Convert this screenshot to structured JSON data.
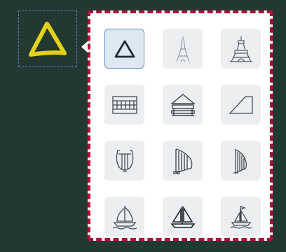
{
  "selected_shape": {
    "icon": "triangle-icon",
    "color": "#e3d21c"
  },
  "palette": {
    "border_color": "#b0103a",
    "items": [
      {
        "icon": "triangle-icon",
        "selected": true
      },
      {
        "icon": "eiffel-tower-icon",
        "selected": false
      },
      {
        "icon": "tokyo-tower-icon",
        "selected": false
      },
      {
        "icon": "dam-gate-icon",
        "selected": false
      },
      {
        "icon": "pavilion-icon",
        "selected": false
      },
      {
        "icon": "ramp-icon",
        "selected": false
      },
      {
        "icon": "lyre-icon",
        "selected": false
      },
      {
        "icon": "harp-icon",
        "selected": false
      },
      {
        "icon": "small-harp-icon",
        "selected": false
      },
      {
        "icon": "sailboat-icon",
        "selected": false
      },
      {
        "icon": "sailboat-outline-icon",
        "selected": false
      },
      {
        "icon": "sailing-ship-icon",
        "selected": false
      }
    ]
  }
}
